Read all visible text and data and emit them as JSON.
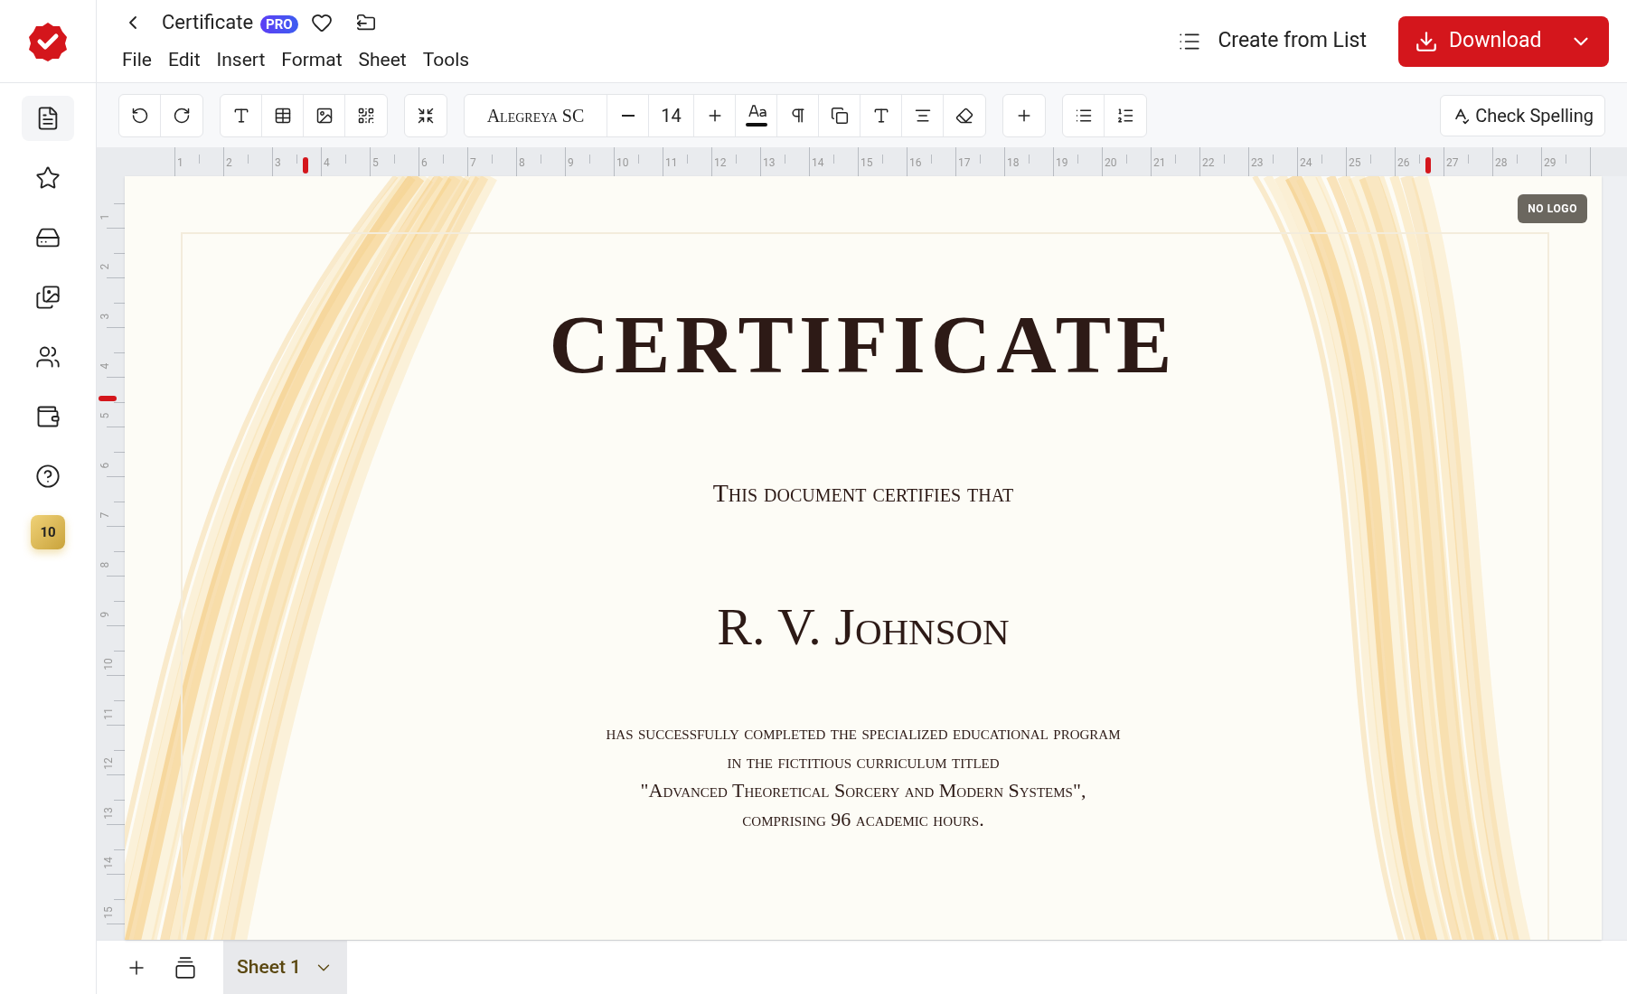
{
  "header": {
    "title": "Certificate",
    "badge": "PRO",
    "menu": [
      "File",
      "Edit",
      "Insert",
      "Format",
      "Sheet",
      "Tools"
    ],
    "create_from_list": "Create from List",
    "download": "Download"
  },
  "sidebar": {
    "items": [
      {
        "selected": true
      },
      {
        "selected": false
      },
      {
        "selected": false
      },
      {
        "selected": false
      },
      {
        "selected": false
      },
      {
        "selected": false
      },
      {
        "selected": false
      }
    ],
    "coins": "10"
  },
  "toolbar": {
    "font": "Alegreya SC",
    "size": "14",
    "spellcheck": "Check Spelling"
  },
  "rulers": {
    "horizontal_numbers": [
      "1",
      "2",
      "3",
      "4",
      "5",
      "6",
      "7",
      "8",
      "9",
      "10",
      "11",
      "12",
      "13",
      "14",
      "15",
      "16",
      "17",
      "18",
      "19",
      "20",
      "21",
      "22",
      "23",
      "24",
      "25",
      "26",
      "27",
      "28",
      "29"
    ],
    "vertical_numbers": [
      "1",
      "2",
      "3",
      "4",
      "5",
      "6",
      "7",
      "8",
      "9",
      "10",
      "11",
      "12",
      "13",
      "14",
      "15"
    ]
  },
  "certificate": {
    "logo_badge": "NO LOGO",
    "title": "CERTIFICATE",
    "subtitle": "This document certifies that",
    "name": "R. V. Johnson",
    "body": [
      "has successfully completed the specialized educational program",
      "in the fictitious curriculum titled",
      "\"Advanced Theoretical Sorcery and Modern Systems\",",
      "comprising 96 academic hours."
    ]
  },
  "sheets": [
    {
      "label": "Sheet 1",
      "selected": true
    }
  ]
}
